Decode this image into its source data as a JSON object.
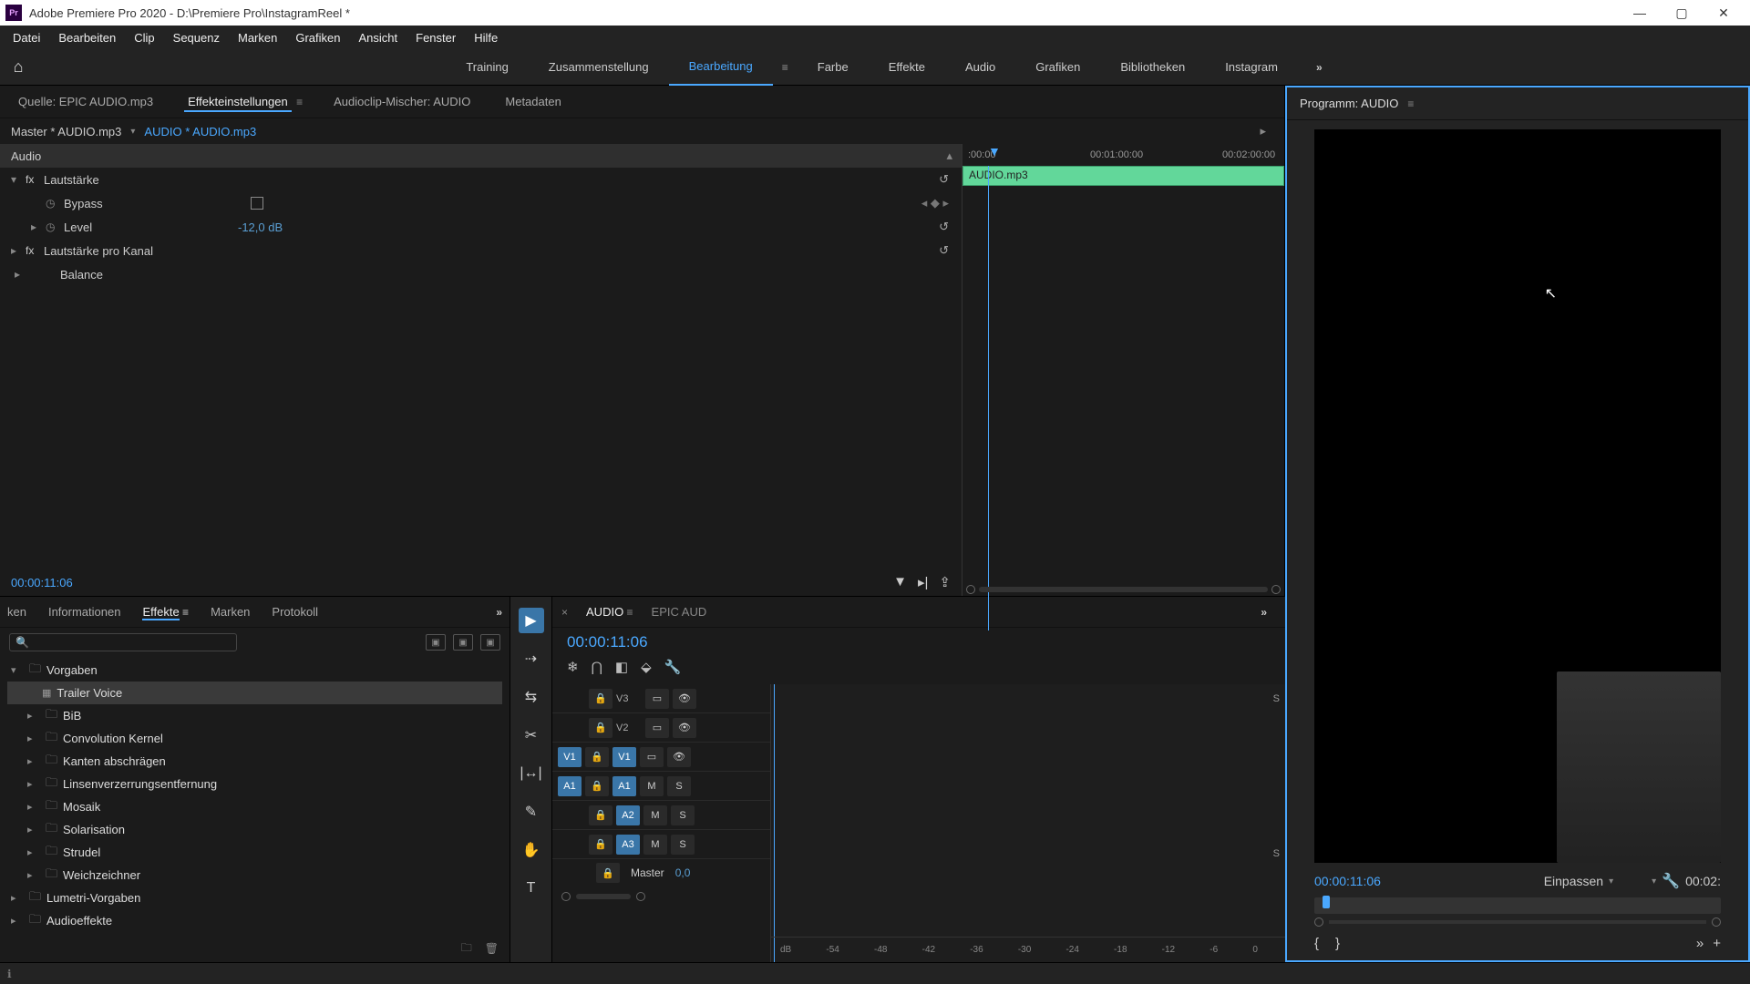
{
  "titlebar": {
    "app_icon": "Pr",
    "title": "Adobe Premiere Pro 2020 - D:\\Premiere Pro\\InstagramReel *"
  },
  "menubar": [
    "Datei",
    "Bearbeiten",
    "Clip",
    "Sequenz",
    "Marken",
    "Grafiken",
    "Ansicht",
    "Fenster",
    "Hilfe"
  ],
  "workspaces": {
    "items": [
      "Training",
      "Zusammenstellung",
      "Bearbeitung",
      "Farbe",
      "Effekte",
      "Audio",
      "Grafiken",
      "Bibliotheken",
      "Instagram"
    ],
    "active": "Bearbeitung"
  },
  "source_tabs": {
    "source": "Quelle: EPIC AUDIO.mp3",
    "effect_controls": "Effekteinstellungen",
    "audio_mixer": "Audioclip-Mischer: AUDIO",
    "metadata": "Metadaten"
  },
  "effect_controls": {
    "master": "Master * AUDIO.mp3",
    "clip": "AUDIO * AUDIO.mp3",
    "section_audio": "Audio",
    "lautstaerke": "Lautstärke",
    "bypass": "Bypass",
    "level": "Level",
    "level_value": "-12,0 dB",
    "lautstaerke_kanal": "Lautstärke pro Kanal",
    "balance": "Balance",
    "timecode": "00:00:11:06",
    "ruler": {
      "t0": ":00:00",
      "t1": "00:01:00:00",
      "t2": "00:02:00:00"
    },
    "clip_label": "AUDIO.mp3"
  },
  "effects_panel": {
    "tabs": {
      "ken": "ken",
      "info": "Informationen",
      "effekte": "Effekte",
      "marken": "Marken",
      "protokoll": "Protokoll"
    },
    "tree": {
      "vorgaben": "Vorgaben",
      "trailer_voice": "Trailer Voice",
      "folders": [
        "BiB",
        "Convolution Kernel",
        "Kanten abschrägen",
        "Linsenverzerrungsentfernung",
        "Mosaik",
        "Solarisation",
        "Strudel",
        "Weichzeichner"
      ],
      "lumetri": "Lumetri-Vorgaben",
      "audioeffekte": "Audioeffekte"
    }
  },
  "timeline": {
    "tabs": {
      "audio": "AUDIO",
      "epic": "EPIC AUD"
    },
    "timecode": "00:00:11:06",
    "tracks": {
      "v3": "V3",
      "v2": "V2",
      "v1_src": "V1",
      "v1": "V1",
      "a1_src": "A1",
      "a1": "A1",
      "a2": "A2",
      "a3": "A3",
      "m": "M",
      "s": "S",
      "master": "Master",
      "master_val": "0,0"
    },
    "meter_labels": [
      "dB",
      "-54",
      "-48",
      "-42",
      "-36",
      "-30",
      "-24",
      "-18",
      "-12",
      "-6",
      "0"
    ]
  },
  "program": {
    "tab": "Programm: AUDIO",
    "timecode": "00:00:11:06",
    "fit": "Einpassen",
    "duration": "00:02:"
  }
}
